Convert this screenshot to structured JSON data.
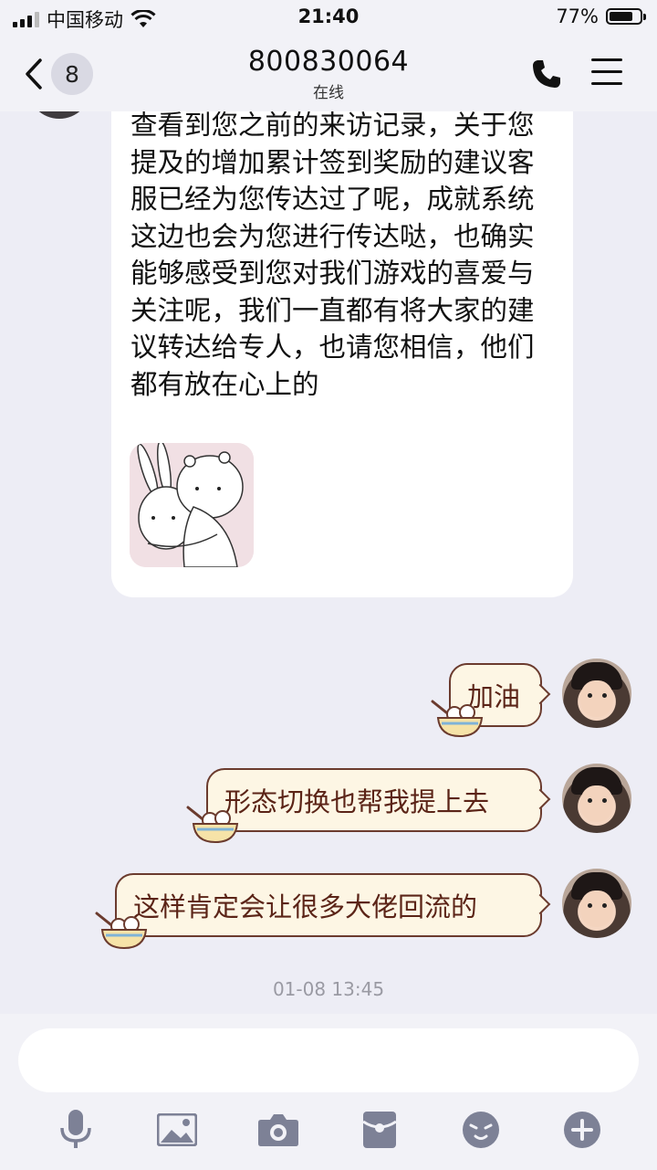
{
  "status_bar": {
    "carrier": "中国移动",
    "time": "21:40",
    "battery_percent": "77%",
    "battery_level": 0.77
  },
  "header": {
    "back_count": "8",
    "title": "800830064",
    "subtitle": "在线"
  },
  "messages": {
    "incoming_text": "查看到您之前的来访记录，关于您提及的增加累计签到奖励的建议客服已经为您传达过了呢，成就系统这边也会为您进行传达哒，也确实能够感受到您对我们游戏的喜爱与关注呢，我们一直都有将大家的建议转达给专人，也请您相信，他们都有放在心上的",
    "outgoing": [
      "加油",
      "形态切换也帮我提上去",
      "这样肯定会让很多大佬回流的"
    ],
    "timestamp": "01-08 13:45"
  },
  "input": {
    "placeholder": ""
  },
  "toolbar": {
    "icons": [
      "microphone-icon",
      "image-icon",
      "camera-icon",
      "red-packet-icon",
      "emoji-icon",
      "plus-icon"
    ]
  },
  "colors": {
    "background": "#ededf5",
    "bubble_out_fill": "#fdf6e4",
    "bubble_out_border": "#6b3b2e",
    "bubble_out_text": "#5b2417"
  }
}
